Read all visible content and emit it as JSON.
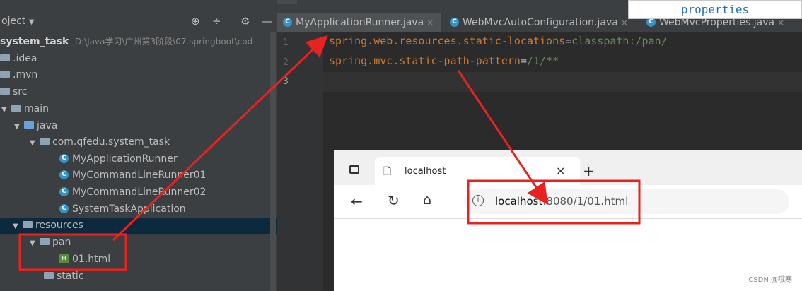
{
  "banner": {
    "text": "properties"
  },
  "project": {
    "title": "oject",
    "root": {
      "name": "system_task",
      "path": "D:\\Java学习\\广州第3阶段\\07.springboot\\cod"
    },
    "items": [
      {
        "label": ".idea"
      },
      {
        "label": ".mvn"
      },
      {
        "label": "src"
      },
      {
        "label": "main"
      },
      {
        "label": "java"
      },
      {
        "label": "com.qfedu.system_task"
      },
      {
        "label": "MyApplicationRunner"
      },
      {
        "label": "MyCommandLineRunner01"
      },
      {
        "label": "MyCommandLineRunner02"
      },
      {
        "label": "SystemTaskApplication"
      },
      {
        "label": "resources"
      },
      {
        "label": "pan"
      },
      {
        "label": "01.html"
      },
      {
        "label": "static"
      }
    ]
  },
  "tabs": [
    {
      "label": "MyApplicationRunner.java"
    },
    {
      "label": "WebMvcAutoConfiguration.java"
    },
    {
      "label": "WebMvcProperties.java"
    }
  ],
  "editor": {
    "line_numbers": [
      "1",
      "2",
      "3"
    ],
    "lines": [
      {
        "key": "spring.web.resources.static-locations",
        "eq": "=",
        "value": "classpath:/pan/"
      },
      {
        "key": "spring.mvc.static-path-pattern",
        "eq": "=",
        "value": "/1/**"
      }
    ]
  },
  "browser": {
    "tab_title": "localhost",
    "url_host": "localhost",
    "url_rest": ":8080/1/01.html"
  },
  "watermark": "CSDN @哦寒",
  "colors": {
    "annotation_red": "#e8231f",
    "selection": "#0d293e"
  }
}
